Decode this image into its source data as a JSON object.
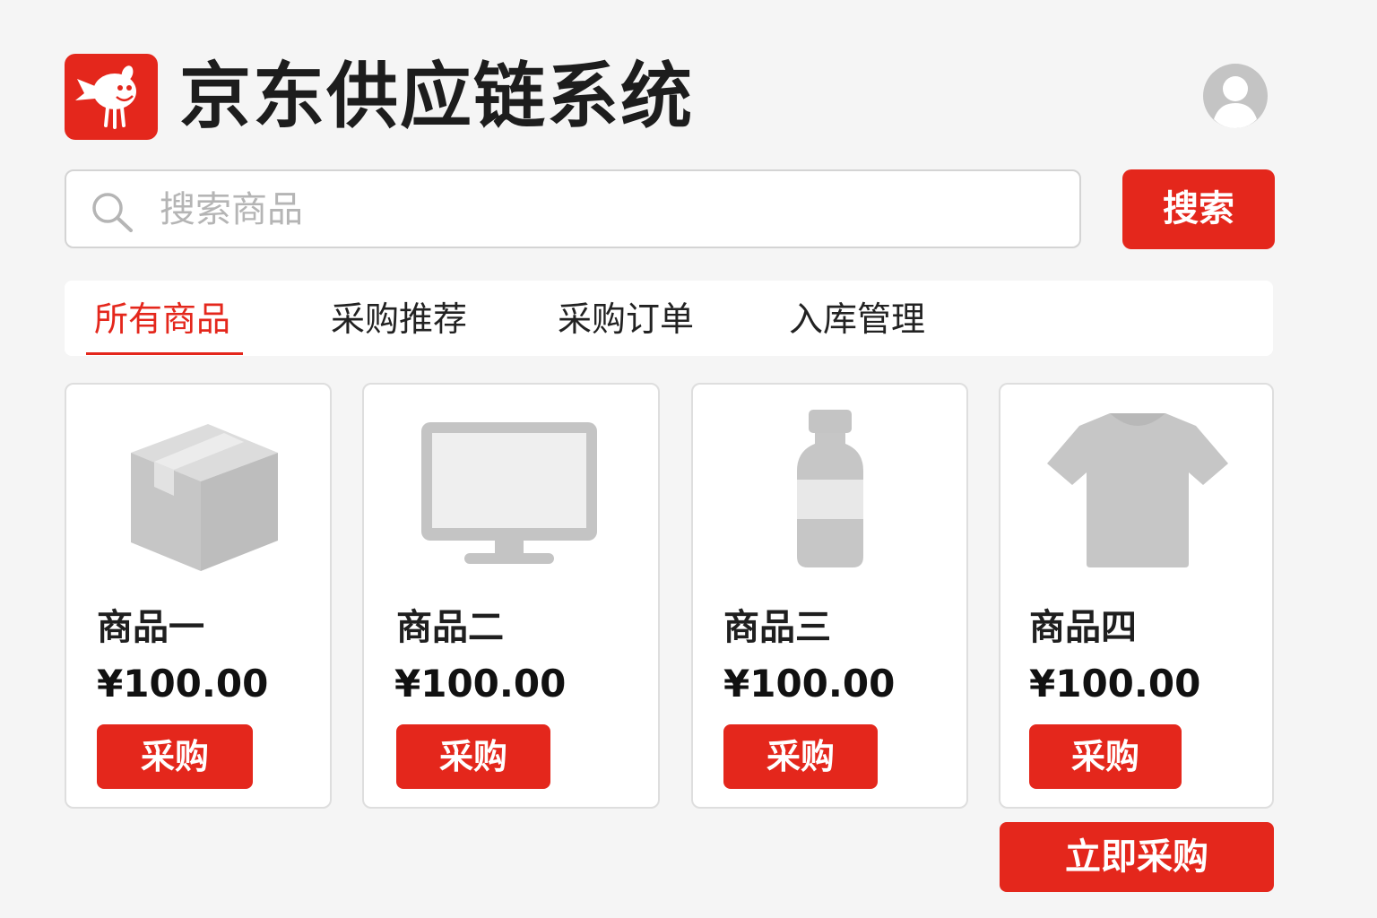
{
  "header": {
    "title": "京东供应链系统",
    "logo_icon": "jd-mascot-logo-icon",
    "avatar_icon": "user-avatar-icon"
  },
  "search": {
    "placeholder": "搜索商品",
    "value": "",
    "button_label": "搜索",
    "icon": "search-icon"
  },
  "tabs": [
    {
      "label": "所有商品",
      "active": true
    },
    {
      "label": "采购推荐",
      "active": false
    },
    {
      "label": "采购订单",
      "active": false
    },
    {
      "label": "入库管理",
      "active": false
    }
  ],
  "products": [
    {
      "name": "商品一",
      "price": "¥100.00",
      "button": "采购",
      "icon": "box-icon"
    },
    {
      "name": "商品二",
      "price": "¥100.00",
      "button": "采购",
      "icon": "monitor-icon"
    },
    {
      "name": "商品三",
      "price": "¥100.00",
      "button": "采购",
      "icon": "bottle-icon"
    },
    {
      "name": "商品四",
      "price": "¥100.00",
      "button": "采购",
      "icon": "tshirt-icon"
    }
  ],
  "actions": {
    "buy_now_label": "立即采购"
  },
  "colors": {
    "accent": "#e4271c",
    "background": "#f5f5f5",
    "placeholder_icon": "#c8c8c8"
  }
}
